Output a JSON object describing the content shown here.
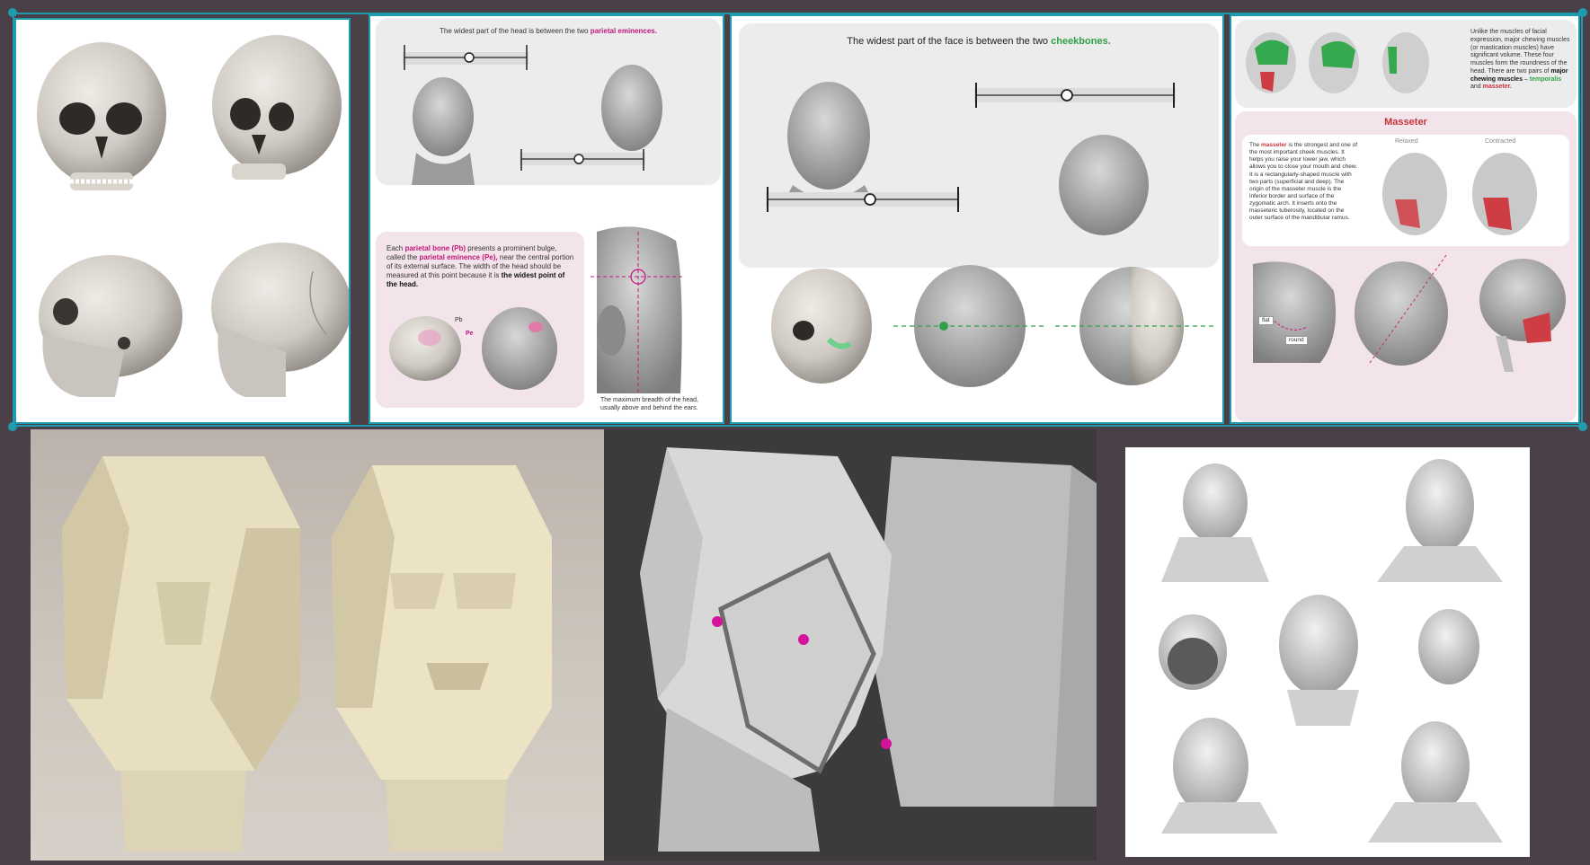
{
  "board": {
    "background": "#4a4048",
    "selection_color": "#1f9bb0"
  },
  "parietal": {
    "title_prefix": "The widest part of the head is between the two",
    "title_highlight": "parietal eminences.",
    "body_prefix": "Each",
    "body_term1": "parietal bone (Pb)",
    "body_mid1": "presents a prominent bulge, called the",
    "body_term2": "parietal eminence (Pe),",
    "body_mid2": "near the central portion of its external surface. The width of the head should be measured at this point because it is",
    "body_strong": "the widest point of the head.",
    "label_pb": "Pb",
    "label_pe": "Pe",
    "side_caption": "The maximum breadth of the head, usually above and behind the ears."
  },
  "cheek": {
    "title_prefix": "The widest part of the face is between the two",
    "title_highlight": "cheekbones."
  },
  "masseter": {
    "intro_1": "Unlike the muscles of facial expression, major chewing muscles (or mastication muscles) have significant volume. These four muscles form the roundness of the head. There are two pairs of",
    "intro_strong": "major chewing muscles",
    "intro_dash": " –",
    "intro_green": "temporalis",
    "intro_and": "and",
    "intro_red": "masseter.",
    "heading": "Masseter",
    "body_prefix": "The",
    "body_term": "masseter",
    "body_rest": "is the strongest and one of the most important cheek muscles. It helps you raise your lower jaw, which allows you to close your mouth and chew. It is a rectangularly-shaped muscle with two parts (superficial and deep). The origin of the masseter muscle is the inferior border and surface of the zygomatic arch. It inserts onto the masseteric tuberosity, located on the outer surface of the mandibular ramus.",
    "label_relaxed": "Relaxed",
    "label_contracted": "Contracted",
    "tag_flat": "flat",
    "tag_round": "round"
  }
}
